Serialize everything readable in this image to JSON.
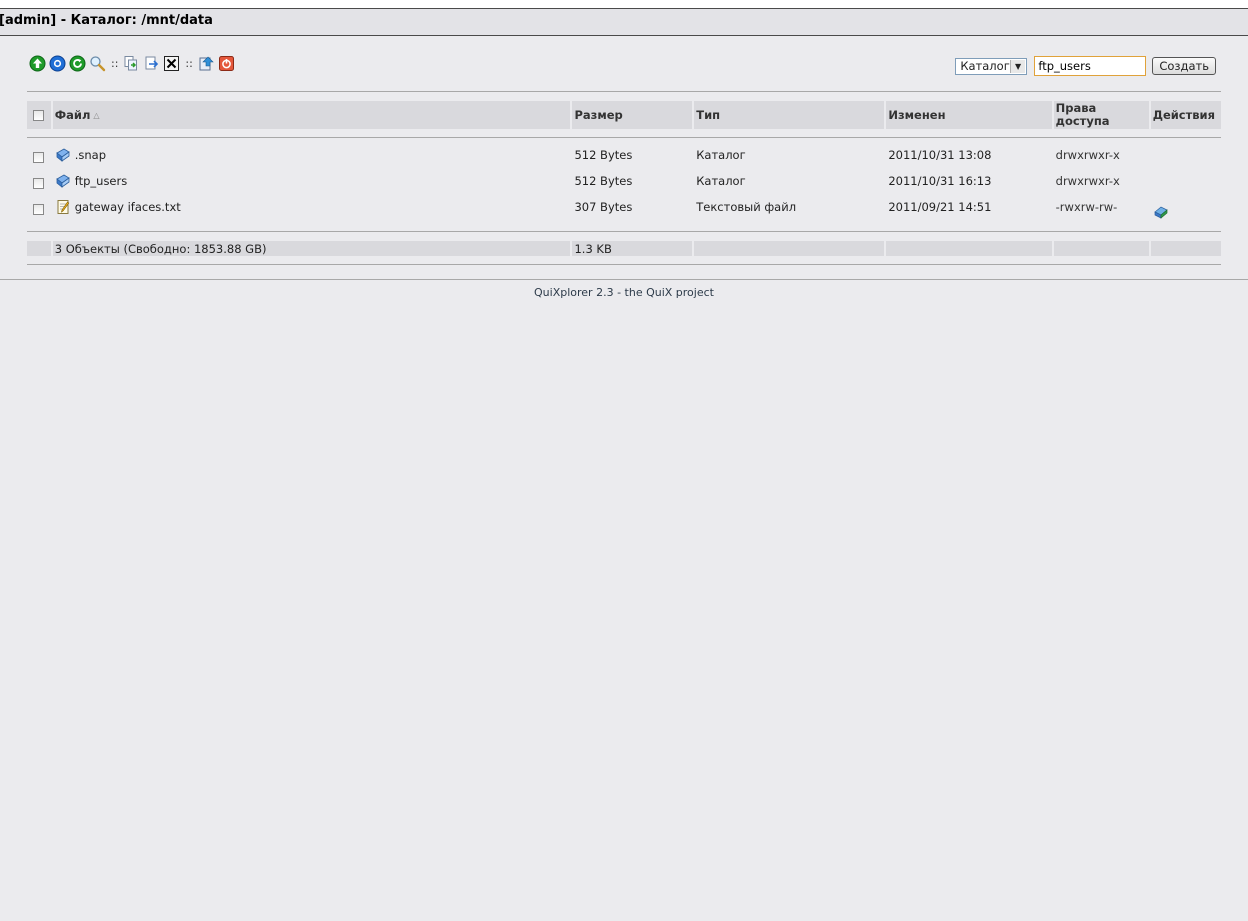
{
  "header": {
    "title": "[admin] - Каталог: /mnt/data"
  },
  "toolbar": {
    "icons": [
      "up-icon",
      "home-icon",
      "reload-icon",
      "search-icon",
      "copy-icon",
      "move-icon",
      "delete-icon",
      "upload-icon",
      "logout-icon"
    ],
    "separator": "::"
  },
  "create": {
    "type_selected": "Каталог",
    "name_value": "ftp_users",
    "button_label": "Создать"
  },
  "table": {
    "columns": {
      "name": "Файл",
      "size": "Размер",
      "type": "Тип",
      "modified": "Изменен",
      "perms": "Права доступа",
      "actions": "Действия"
    },
    "sort_marker": "△",
    "rows": [
      {
        "name": ".snap",
        "icon": "folder-icon",
        "size": "512 Bytes",
        "type": "Каталог",
        "modified": "2011/10/31 13:08",
        "perms": "drwxrwxr-x",
        "has_action": false
      },
      {
        "name": "ftp_users",
        "icon": "folder-icon",
        "size": "512 Bytes",
        "type": "Каталог",
        "modified": "2011/10/31 16:13",
        "perms": "drwxrwxr-x",
        "has_action": false
      },
      {
        "name": "gateway ifaces.txt",
        "icon": "text-file-icon",
        "size": "307 Bytes",
        "type": "Текстовый файл",
        "modified": "2011/09/21 14:51",
        "perms": "-rwxrw-rw-",
        "has_action": true
      }
    ],
    "summary": {
      "objects": "3 Объекты (Свободно: 1853.88 GB)",
      "total_size": "1.3 KB"
    }
  },
  "footer": {
    "credit": "QuiXplorer 2.3 - the QuiX project"
  }
}
